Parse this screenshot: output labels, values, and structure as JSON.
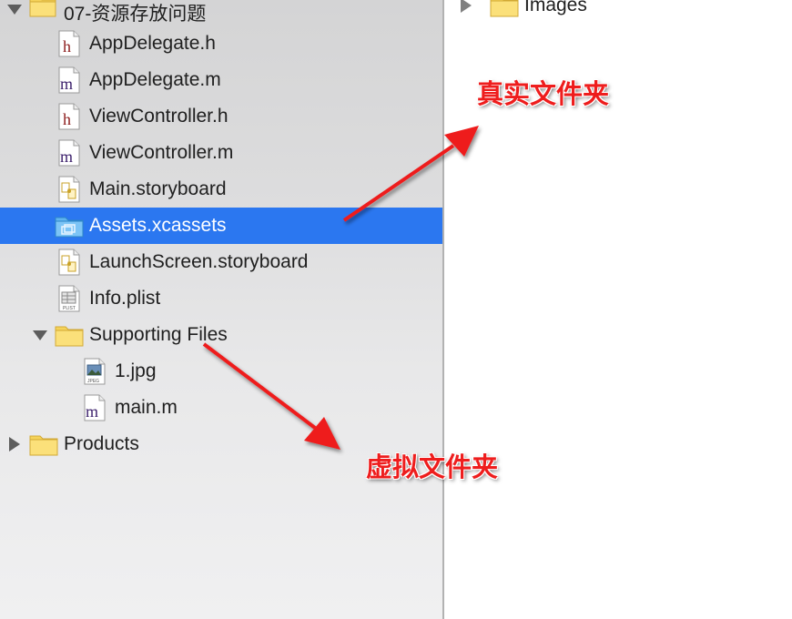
{
  "navigator": {
    "group_name": "07-资源存放问题",
    "files": [
      {
        "name": "AppDelegate.h",
        "icon": "header-file-icon"
      },
      {
        "name": "AppDelegate.m",
        "icon": "source-file-icon"
      },
      {
        "name": "ViewController.h",
        "icon": "header-file-icon"
      },
      {
        "name": "ViewController.m",
        "icon": "source-file-icon"
      },
      {
        "name": "Main.storyboard",
        "icon": "storyboard-icon"
      },
      {
        "name": "Assets.xcassets",
        "icon": "asset-catalog-icon"
      },
      {
        "name": "LaunchScreen.storyboard",
        "icon": "storyboard-icon"
      },
      {
        "name": "Info.plist",
        "icon": "plist-icon"
      }
    ],
    "supporting_files": {
      "name": "Supporting Files",
      "children": [
        {
          "name": "1.jpg",
          "icon": "jpeg-file-icon"
        },
        {
          "name": "main.m",
          "icon": "source-file-icon"
        }
      ]
    },
    "products": "Products",
    "selected": "Assets.xcassets"
  },
  "finder": {
    "folder_name": "Images"
  },
  "annotations": {
    "real_folder": "真实文件夹",
    "virtual_folder": "虚拟文件夹",
    "color": "#ee1d1d"
  },
  "colors": {
    "selection": "#2b77f0",
    "folder": "#f5d35a",
    "header_letter": "#8b1a1a",
    "source_letter": "#3b1f6b"
  }
}
